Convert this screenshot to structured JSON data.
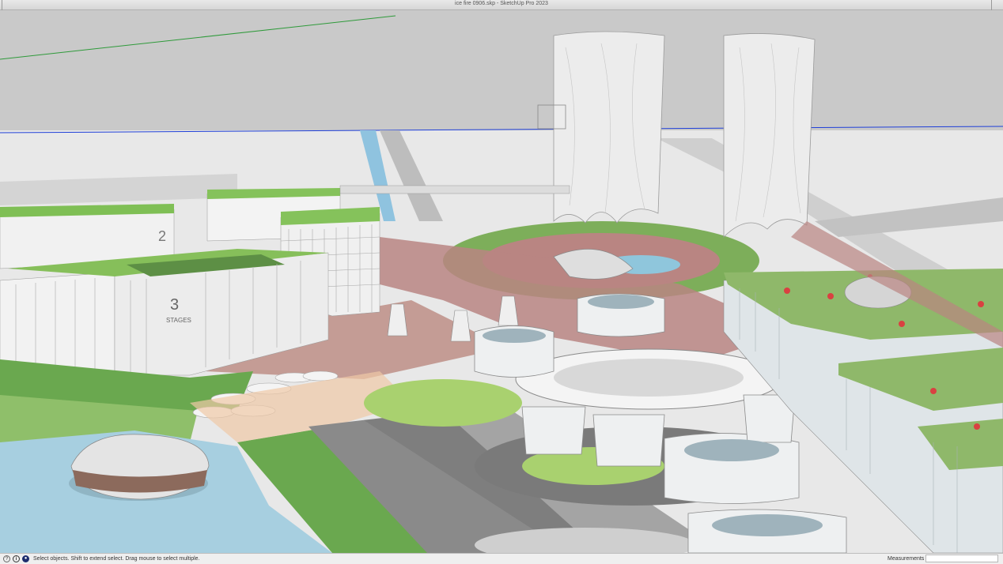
{
  "window": {
    "title": "ice fire 0906.skp - SketchUp Pro 2023"
  },
  "viewport": {
    "scene": "3D model view of an urban master plan with two perforated towers, circular ring structures, green roofs and a waterfront",
    "building_labels": {
      "stages2_number": "2",
      "stages3_number": "3",
      "stages3_word": "STAGES"
    }
  },
  "statusbar": {
    "icons": [
      "help-icon",
      "info-icon",
      "user-icon"
    ],
    "hint": "Select objects. Shift to extend select. Drag mouse to select multiple.",
    "measurements_label": "Measurements",
    "measurements_value": ""
  },
  "colors": {
    "sky": "#c9c9c9",
    "ground": "#e9e9e9",
    "water": "#a7cfe0",
    "grass": "#6aa84f",
    "path": "#b98582",
    "tower": "#e6e6e6",
    "green_axis": "#2e9a3a",
    "blue_axis": "#1f3fd8"
  }
}
